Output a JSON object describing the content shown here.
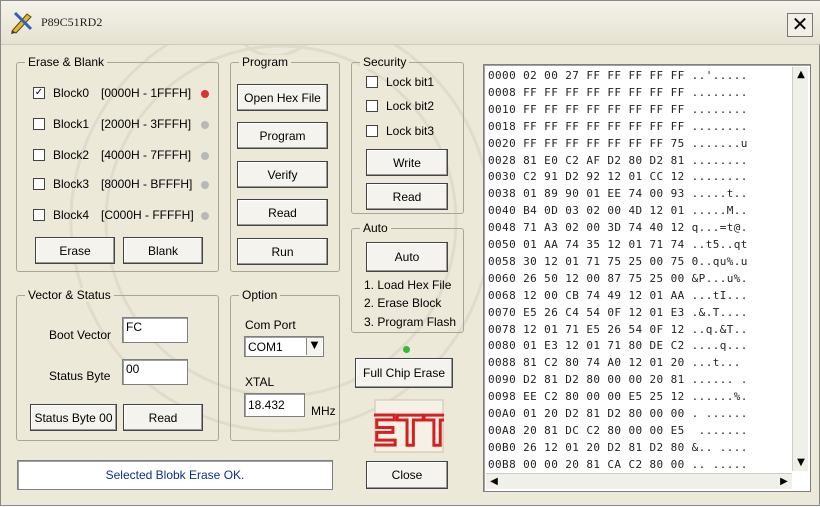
{
  "window": {
    "title": "P89C51RD2",
    "close_glyph": "✕"
  },
  "erase_blank": {
    "group_label": "Erase & Blank",
    "blocks": [
      {
        "label": "Block0",
        "range": "[0000H - 1FFFH]",
        "checked": true,
        "led": "red"
      },
      {
        "label": "Block1",
        "range": "[2000H - 3FFFH]",
        "checked": false,
        "led": "gray"
      },
      {
        "label": "Block2",
        "range": "[4000H - 7FFFH]",
        "checked": false,
        "led": "gray"
      },
      {
        "label": "Block3",
        "range": "[8000H - BFFFH]",
        "checked": false,
        "led": "gray"
      },
      {
        "label": "Block4",
        "range": "[C000H - FFFFH]",
        "checked": false,
        "led": "gray"
      }
    ],
    "erase_label": "Erase",
    "blank_label": "Blank"
  },
  "program": {
    "group_label": "Program",
    "open_hex_label": "Open Hex File",
    "program_label": "Program",
    "verify_label": "Verify",
    "read_label": "Read",
    "run_label": "Run"
  },
  "security": {
    "group_label": "Security",
    "lock_bits": [
      {
        "label": "Lock bit1",
        "checked": false
      },
      {
        "label": "Lock bit2",
        "checked": false
      },
      {
        "label": "Lock bit3",
        "checked": false
      }
    ],
    "write_label": "Write",
    "read_label": "Read"
  },
  "auto": {
    "group_label": "Auto",
    "auto_label": "Auto",
    "steps": [
      "1. Load Hex File",
      "2. Erase Block",
      "3. Program Flash"
    ]
  },
  "vector_status": {
    "group_label": "Vector & Status",
    "boot_vector_label": "Boot Vector",
    "boot_vector_value": "FC",
    "status_byte_label": "Status Byte",
    "status_byte_value": "00",
    "status_byte_00_label": "Status Byte 00",
    "read_label": "Read"
  },
  "option": {
    "group_label": "Option",
    "com_port_label": "Com Port",
    "com_port_value": "COM1",
    "xtal_label": "XTAL",
    "xtal_value": "18.432",
    "xtal_unit": "MHz"
  },
  "full_chip_erase_label": "Full Chip Erase",
  "logo_text": "ETT",
  "close_label": "Close",
  "status_message": "Selected Blobk Erase OK.",
  "hex_dump": [
    "0000 02 00 27 FF FF FF FF FF ..'.....",
    "0008 FF FF FF FF FF FF FF FF ........",
    "0010 FF FF FF FF FF FF FF FF ........",
    "0018 FF FF FF FF FF FF FF FF ........",
    "0020 FF FF FF FF FF FF FF 75 .......u",
    "0028 81 E0 C2 AF D2 80 D2 81 ........",
    "0030 C2 91 D2 92 12 01 CC 12 ........",
    "0038 01 89 90 01 EE 74 00 93 .....t..",
    "0040 B4 0D 03 02 00 4D 12 01 .....M..",
    "0048 71 A3 02 00 3D 74 40 12 q...=t@.",
    "0050 01 AA 74 35 12 01 71 74 ..t5..qt",
    "0058 30 12 01 71 75 25 00 75 0..qu%.u",
    "0060 26 50 12 00 87 75 25 00 &P...u%.",
    "0068 12 00 CB 74 49 12 01 AA ...tI...",
    "0070 E5 26 C4 54 0F 12 01 E3 .&.T....",
    "0078 12 01 71 E5 26 54 0F 12 ..q.&T..",
    "0080 01 E3 12 01 71 80 DE C2 ....q...",
    "0088 81 C2 80 74 A0 12 01 20 ...t...",
    "0090 D2 81 D2 80 00 00 20 81 ...... .",
    "0098 EE C2 80 00 00 E5 25 12 ......%.",
    "00A0 01 20 D2 81 D2 80 00 00 . ......",
    "00A8 20 81 DC C2 80 00 00 E5  .......",
    "00B0 26 12 01 20 D2 81 D2 80 &.. ....",
    "00B8 00 00 20 81 CA C2 80 00 .. ....."
  ],
  "colors": {
    "background": "#ece9d8",
    "status_text": "#0d2f8f",
    "logo_red": "#d61f1f",
    "led_red": "#e03030",
    "led_green": "#33bb33",
    "led_gray": "#b8b8b8"
  },
  "icons": {
    "app": "pen-tools-icon",
    "close": "close-icon"
  }
}
